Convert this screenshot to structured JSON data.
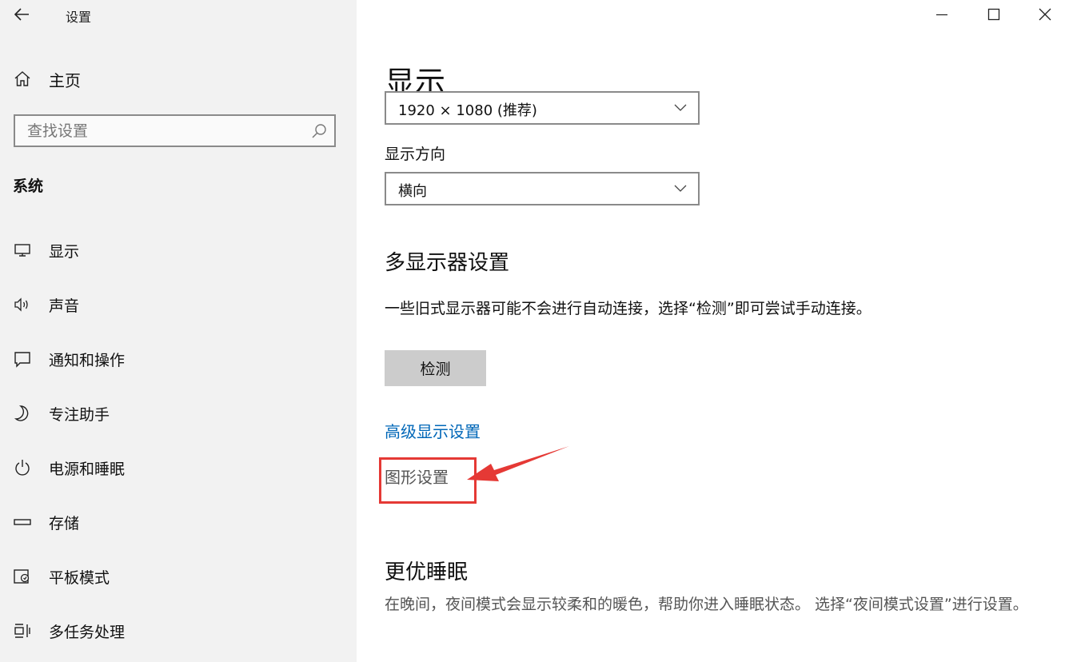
{
  "app": {
    "title": "设置"
  },
  "window_controls": {
    "minimize": "minimize-icon",
    "maximize": "maximize-icon",
    "close": "close-icon"
  },
  "sidebar": {
    "home_label": "主页",
    "search_placeholder": "查找设置",
    "section": "系统",
    "items": [
      {
        "label": "显示",
        "icon": "monitor-icon"
      },
      {
        "label": "声音",
        "icon": "speaker-icon"
      },
      {
        "label": "通知和操作",
        "icon": "notification-icon"
      },
      {
        "label": "专注助手",
        "icon": "moon-icon"
      },
      {
        "label": "电源和睡眠",
        "icon": "power-icon"
      },
      {
        "label": "存储",
        "icon": "storage-icon"
      },
      {
        "label": "平板模式",
        "icon": "tablet-icon"
      },
      {
        "label": "多任务处理",
        "icon": "multitask-icon"
      }
    ]
  },
  "main": {
    "title": "显示",
    "resolution_value": "1920 × 1080 (推荐)",
    "orientation_label": "显示方向",
    "orientation_value": "横向",
    "multi_display_heading": "多显示器设置",
    "multi_display_desc": "一些旧式显示器可能不会进行自动连接，选择“检测”即可尝试手动连接。",
    "detect_button": "检测",
    "advanced_link": "高级显示设置",
    "graphics_link": "图形设置",
    "sleep_heading": "更优睡眠",
    "sleep_desc": "在晚间，夜间模式会显示较柔和的暖色，帮助你进入睡眠状态。 选择“夜间模式设置”进行设置。"
  },
  "colors": {
    "link": "#0067b8",
    "highlight": "#e53935",
    "sidebar_bg": "#f2f2f2",
    "button_bg": "#cccccc"
  }
}
